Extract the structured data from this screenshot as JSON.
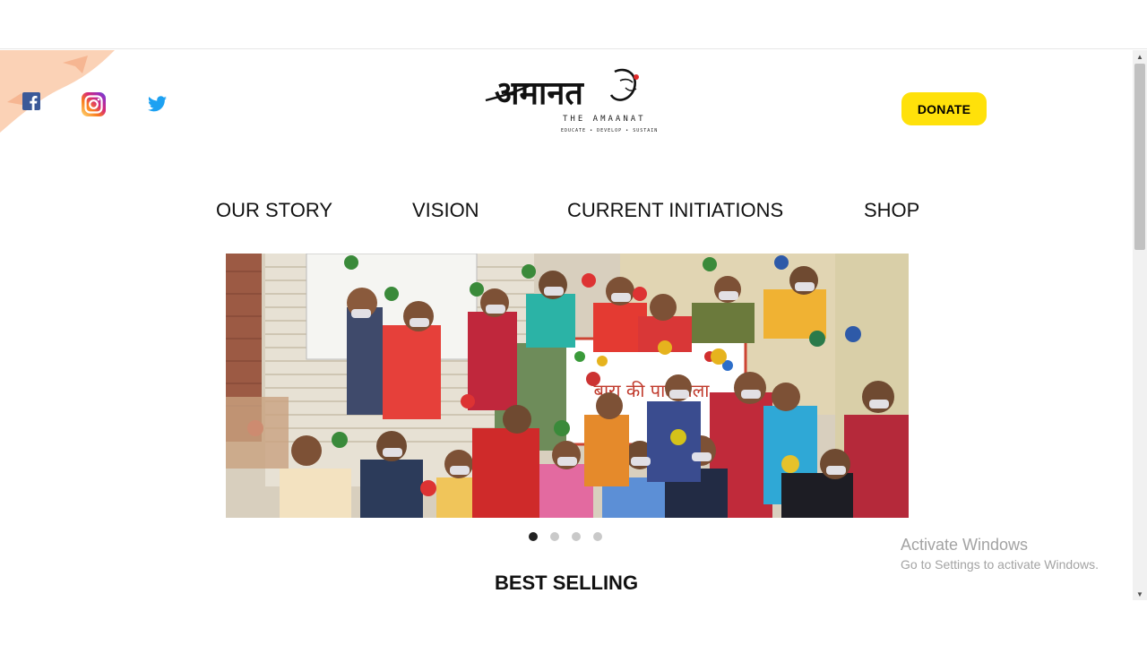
{
  "header": {
    "social": [
      {
        "icon": "facebook-icon"
      },
      {
        "icon": "instagram-icon"
      },
      {
        "icon": "twitter-icon"
      }
    ],
    "logo": {
      "script_text": "अमानत",
      "subtitle": "THE AMAANAT",
      "tagline": "EDUCATE • DEVELOP • SUSTAIN"
    },
    "donate_label": "DONATE"
  },
  "nav": {
    "items": [
      {
        "label": "OUR STORY"
      },
      {
        "label": "VISION"
      },
      {
        "label": "CURRENT INITIATIONS"
      },
      {
        "label": "SHOP"
      }
    ]
  },
  "hero": {
    "slide_count": 4,
    "active_slide": 1,
    "banner_text": "बारा की पाठशाला"
  },
  "sections": {
    "best_selling": "BEST SELLING"
  },
  "watermark": {
    "line1": "Activate Windows",
    "line2": "Go to Settings to activate Windows."
  },
  "colors": {
    "donate_bg": "#ffe10a",
    "facebook": "#3b5998",
    "twitter": "#1da1f2",
    "corner_deco": "#fbd2b6"
  }
}
